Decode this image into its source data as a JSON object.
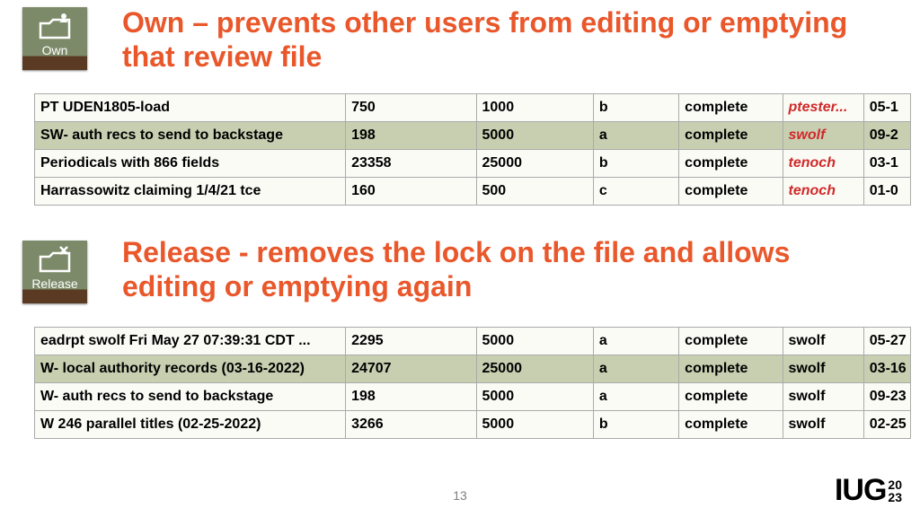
{
  "own": {
    "icon_label": "Own",
    "heading": "Own – prevents other users from editing or emptying that review file",
    "rows": [
      {
        "name": "PT UDEN1805-load",
        "n1": "750",
        "n2": "1000",
        "let": "b",
        "stat": "complete",
        "user": "ptester...",
        "user_red": true,
        "date": "05-1"
      },
      {
        "name": "SW- auth recs to send to backstage",
        "n1": "198",
        "n2": "5000",
        "let": "a",
        "stat": "complete",
        "user": "swolf",
        "user_red": true,
        "date": "09-2",
        "sel": true
      },
      {
        "name": "Periodicals with 866 fields",
        "n1": "23358",
        "n2": "25000",
        "let": "b",
        "stat": "complete",
        "user": "tenoch",
        "user_red": true,
        "date": "03-1"
      },
      {
        "name": "Harrassowitz claiming 1/4/21 tce",
        "n1": "160",
        "n2": "500",
        "let": "c",
        "stat": "complete",
        "user": "tenoch",
        "user_red": true,
        "date": "01-0"
      }
    ]
  },
  "rel": {
    "icon_label": "Release",
    "heading": "Release - removes the lock on the file and allows editing or emptying again",
    "rows": [
      {
        "name": "eadrpt swolf Fri May 27 07:39:31 CDT ...",
        "n1": "2295",
        "n2": "5000",
        "let": "a",
        "stat": "complete",
        "user": "swolf",
        "user_red": false,
        "date": "05-27"
      },
      {
        "name": "W- local authority records (03-16-2022)",
        "n1": "24707",
        "n2": "25000",
        "let": "a",
        "stat": "complete",
        "user": "swolf",
        "user_red": false,
        "date": "03-16",
        "sel": true
      },
      {
        "name": "W- auth recs to send to backstage",
        "n1": "198",
        "n2": "5000",
        "let": "a",
        "stat": "complete",
        "user": "swolf",
        "user_red": false,
        "date": "09-23"
      },
      {
        "name": "W 246 parallel titles (02-25-2022)",
        "n1": "3266",
        "n2": "5000",
        "let": "b",
        "stat": "complete",
        "user": "swolf",
        "user_red": false,
        "date": "02-25"
      }
    ]
  },
  "footer": {
    "page": "13",
    "logo_main": "IUG",
    "logo_top": "20",
    "logo_bot": "23"
  }
}
